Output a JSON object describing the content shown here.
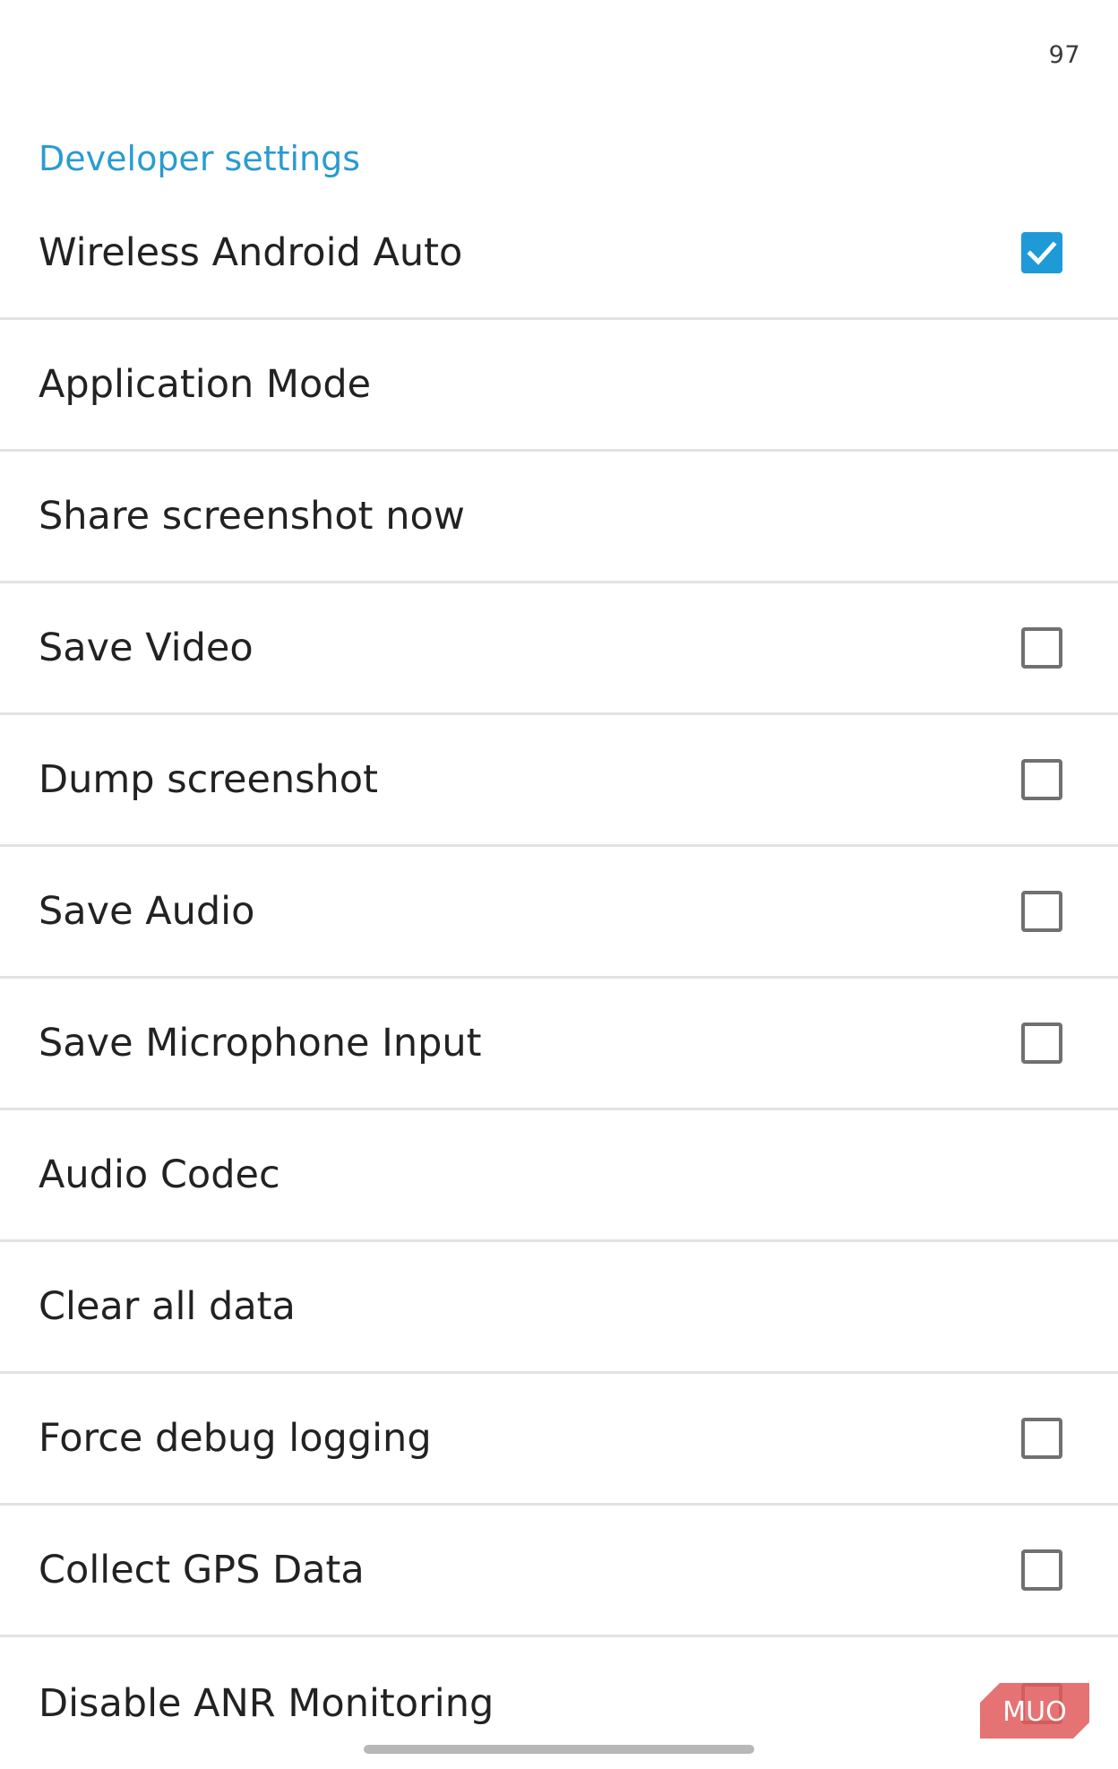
{
  "status_bar": {
    "value": "97"
  },
  "section": {
    "title": "Developer settings"
  },
  "settings": [
    {
      "label": "Wireless Android Auto",
      "has_checkbox": true,
      "checked": true
    },
    {
      "label": "Application Mode",
      "has_checkbox": false,
      "checked": false
    },
    {
      "label": "Share screenshot now",
      "has_checkbox": false,
      "checked": false
    },
    {
      "label": "Save Video",
      "has_checkbox": true,
      "checked": false
    },
    {
      "label": "Dump screenshot",
      "has_checkbox": true,
      "checked": false
    },
    {
      "label": "Save Audio",
      "has_checkbox": true,
      "checked": false
    },
    {
      "label": "Save Microphone Input",
      "has_checkbox": true,
      "checked": false
    },
    {
      "label": "Audio Codec",
      "has_checkbox": false,
      "checked": false
    },
    {
      "label": "Clear all data",
      "has_checkbox": false,
      "checked": false
    },
    {
      "label": "Force debug logging",
      "has_checkbox": true,
      "checked": false
    },
    {
      "label": "Collect GPS Data",
      "has_checkbox": true,
      "checked": false
    },
    {
      "label": "Disable ANR Monitoring",
      "has_checkbox": true,
      "checked": false
    }
  ],
  "watermark": {
    "text": "MUO"
  },
  "colors": {
    "accent": "#2a9bd1",
    "checkbox_checked": "#1e9ad6",
    "checkbox_border": "#707070",
    "divider": "#e2e2e2",
    "watermark": "#e05a5a"
  }
}
